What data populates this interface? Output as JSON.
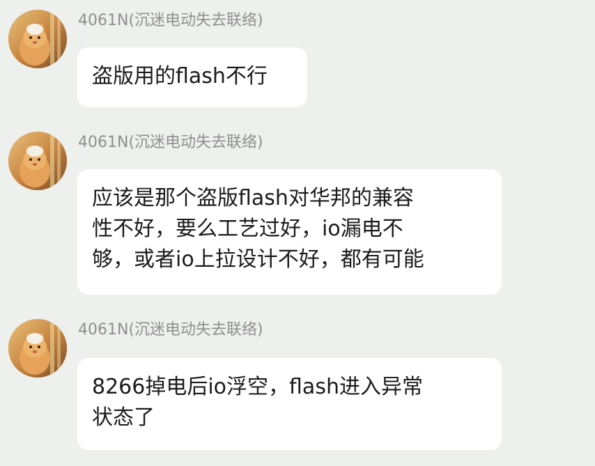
{
  "messages": [
    {
      "sender": "4061N(沉迷电动失去联络)",
      "avatar_icon": "cat-avatar",
      "lines": [
        "盗版用的flash不行"
      ]
    },
    {
      "sender": "4061N(沉迷电动失去联络)",
      "avatar_icon": "cat-avatar",
      "lines": [
        "应该是那个盗版flash对华邦的兼容",
        "性不好，要么工艺过好，io漏电不",
        "够，或者io上拉设计不好，都有可能"
      ]
    },
    {
      "sender": "4061N(沉迷电动失去联络)",
      "avatar_icon": "cat-avatar",
      "lines": [
        "8266掉电后io浮空，flash进入异常",
        "状态了"
      ]
    }
  ],
  "colors": {
    "background": "#eef0ee",
    "bubble": "#ffffff",
    "sender_text": "#8e8e8e",
    "message_text": "#1a1a1a"
  }
}
